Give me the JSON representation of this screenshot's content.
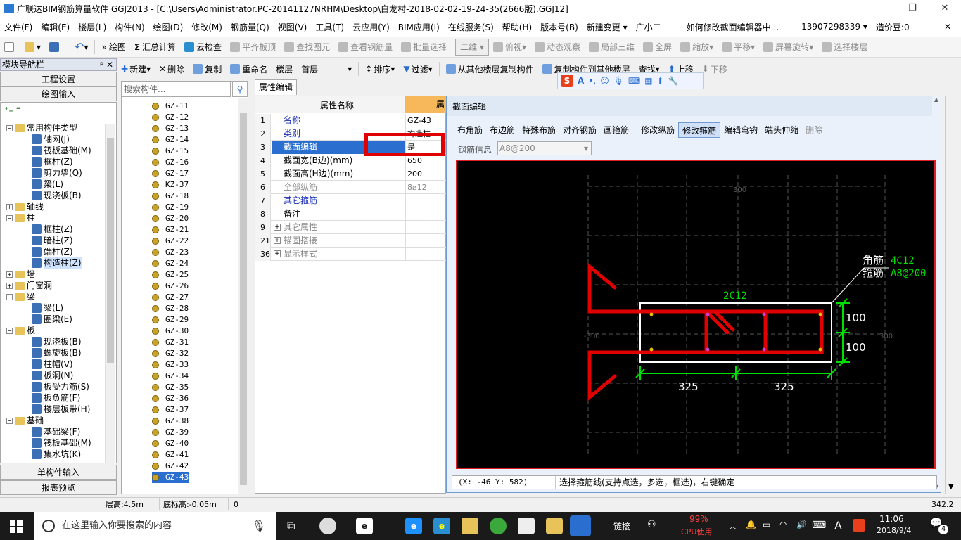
{
  "window": {
    "title": "广联达BIM钢筋算量软件 GGJ2013 - [C:\\Users\\Administrator.PC-20141127NRHM\\Desktop\\白龙村-2018-02-02-19-24-35(2666版).GGJ12]",
    "minimize": "–",
    "restore": "❐",
    "close": "✕"
  },
  "menu": [
    "文件(F)",
    "编辑(E)",
    "楼层(L)",
    "构件(N)",
    "绘图(D)",
    "修改(M)",
    "钢筋量(Q)",
    "视图(V)",
    "工具(T)",
    "云应用(Y)",
    "BIM应用(I)",
    "在线服务(S)",
    "帮助(H)",
    "版本号(B)",
    "新建变更 ▾",
    "广小二",
    "如何修改截面编辑器中...",
    "13907298339 ▾",
    "造价豆:0",
    "✕"
  ],
  "toolbar1": {
    "draw": "绘图",
    "sum": "汇总计算",
    "cloud_check": "云检查",
    "flat_top": "平齐板顶",
    "find_elem": "查找图元",
    "view_rebar": "查看钢筋量",
    "batch_select": "批量选择",
    "view2d": "二维",
    "overlook": "俯视",
    "dyn_observe": "动态观察",
    "local3d": "局部三维",
    "fullscreen": "全屏",
    "zoom": "缩放",
    "pan": "平移",
    "rotate": "屏幕旋转",
    "select_floor": "选择楼层"
  },
  "toolbar2": {
    "new": "新建",
    "delete": "删除",
    "copy": "复制",
    "rename": "重命名",
    "floor_label": "楼层",
    "floor_value": "首层",
    "sort": "排序",
    "filter": "过滤",
    "copy_from": "从其他楼层复制构件",
    "copy_to": "复制构件到其他楼层",
    "find": "查找",
    "up": "上移",
    "down": "下移"
  },
  "nav": {
    "header": "模块导航栏",
    "pin": "ᵖ ✕",
    "project_settings": "工程设置",
    "drawing_input": "绘图输入",
    "single_input": "单构件输入",
    "report_preview": "报表预览",
    "tree": [
      {
        "label": "常用构件类型",
        "type": "folder",
        "level": 0,
        "exp": "−"
      },
      {
        "label": "轴网(J)",
        "type": "comp",
        "level": 1
      },
      {
        "label": "筏板基础(M)",
        "type": "comp",
        "level": 1
      },
      {
        "label": "框柱(Z)",
        "type": "comp",
        "level": 1
      },
      {
        "label": "剪力墙(Q)",
        "type": "comp",
        "level": 1
      },
      {
        "label": "梁(L)",
        "type": "comp",
        "level": 1
      },
      {
        "label": "现浇板(B)",
        "type": "comp",
        "level": 1
      },
      {
        "label": "轴线",
        "type": "folder",
        "level": 0,
        "exp": "+"
      },
      {
        "label": "柱",
        "type": "folder",
        "level": 0,
        "exp": "−"
      },
      {
        "label": "框柱(Z)",
        "type": "comp",
        "level": 1
      },
      {
        "label": "暗柱(Z)",
        "type": "comp",
        "level": 1
      },
      {
        "label": "端柱(Z)",
        "type": "comp",
        "level": 1
      },
      {
        "label": "构造柱(Z)",
        "type": "comp",
        "level": 1,
        "sel": true
      },
      {
        "label": "墙",
        "type": "folder",
        "level": 0,
        "exp": "+"
      },
      {
        "label": "门窗洞",
        "type": "folder",
        "level": 0,
        "exp": "+"
      },
      {
        "label": "梁",
        "type": "folder",
        "level": 0,
        "exp": "−"
      },
      {
        "label": "梁(L)",
        "type": "comp",
        "level": 1
      },
      {
        "label": "圈梁(E)",
        "type": "comp",
        "level": 1
      },
      {
        "label": "板",
        "type": "folder",
        "level": 0,
        "exp": "−"
      },
      {
        "label": "现浇板(B)",
        "type": "comp",
        "level": 1
      },
      {
        "label": "螺旋板(B)",
        "type": "comp",
        "level": 1
      },
      {
        "label": "柱帽(V)",
        "type": "comp",
        "level": 1
      },
      {
        "label": "板洞(N)",
        "type": "comp",
        "level": 1
      },
      {
        "label": "板受力筋(S)",
        "type": "comp",
        "level": 1
      },
      {
        "label": "板负筋(F)",
        "type": "comp",
        "level": 1
      },
      {
        "label": "楼层板带(H)",
        "type": "comp",
        "level": 1
      },
      {
        "label": "基础",
        "type": "folder",
        "level": 0,
        "exp": "−"
      },
      {
        "label": "基础梁(F)",
        "type": "comp",
        "level": 1
      },
      {
        "label": "筏板基础(M)",
        "type": "comp",
        "level": 1
      },
      {
        "label": "集水坑(K)",
        "type": "comp",
        "level": 1
      }
    ]
  },
  "search": {
    "placeholder": "搜索构件...",
    "icon": "⚲"
  },
  "components": [
    "GZ-11",
    "GZ-12",
    "GZ-13",
    "GZ-14",
    "GZ-15",
    "GZ-16",
    "GZ-17",
    "KZ-37",
    "GZ-18",
    "GZ-19",
    "GZ-20",
    "GZ-21",
    "GZ-22",
    "GZ-23",
    "GZ-24",
    "GZ-25",
    "GZ-26",
    "GZ-27",
    "GZ-28",
    "GZ-29",
    "GZ-30",
    "GZ-31",
    "GZ-32",
    "GZ-33",
    "GZ-34",
    "GZ-35",
    "GZ-36",
    "GZ-37",
    "GZ-38",
    "GZ-39",
    "GZ-40",
    "GZ-41",
    "GZ-42",
    "GZ-43"
  ],
  "selected_component": "GZ-43",
  "props": {
    "tab": "属性编辑",
    "col_name": "属性名称",
    "col_value": "属",
    "rows": [
      {
        "num": "1",
        "name": "名称",
        "value": "GZ-43",
        "style": "blue"
      },
      {
        "num": "2",
        "name": "类别",
        "value": "构造柱",
        "style": "blue"
      },
      {
        "num": "3",
        "name": "截面编辑",
        "value": "是",
        "style": "sel"
      },
      {
        "num": "4",
        "name": "截面宽(B边)(mm)",
        "value": "650",
        "style": ""
      },
      {
        "num": "5",
        "name": "截面高(H边)(mm)",
        "value": "200",
        "style": ""
      },
      {
        "num": "6",
        "name": "全部纵筋",
        "value": "8⌀12",
        "style": "gray"
      },
      {
        "num": "7",
        "name": "其它箍筋",
        "value": "",
        "style": "blue"
      },
      {
        "num": "8",
        "name": "备注",
        "value": "",
        "style": ""
      },
      {
        "num": "9",
        "name": "其它属性",
        "value": "",
        "style": "gray",
        "exp": true
      },
      {
        "num": "21",
        "name": "锚固搭接",
        "value": "",
        "style": "gray",
        "exp": true
      },
      {
        "num": "36",
        "name": "显示样式",
        "value": "",
        "style": "gray",
        "exp": true
      }
    ]
  },
  "dialog": {
    "title": "截面编辑",
    "buttons": [
      "布角筋",
      "布边筋",
      "特殊布筋",
      "对齐钢筋",
      "画箍筋",
      "修改纵筋",
      "修改箍筋",
      "编辑弯钩",
      "端头伸缩",
      "删除"
    ],
    "active_button": "修改箍筋",
    "rebar_info_label": "钢筋信息",
    "rebar_info_value": "A8@200",
    "coords": "(X: -46 Y: 582)",
    "hint": "选择箍筋线(支持点选，多选，框选)，右键确定",
    "drawing": {
      "corner_label": "角筋",
      "corner_value": "4C12",
      "stirrup_label": "箍筋",
      "stirrup_value": "A8@200",
      "top_rebar": "2C12",
      "dim_100a": "100",
      "dim_100b": "100",
      "dim_325a": "325",
      "dim_325b": "325",
      "grid_300_top": "300",
      "grid_minus300": "-300",
      "grid_300_right": "300",
      "grid_0": "0"
    }
  },
  "statusbar": {
    "floor_height": "层高:4.5m",
    "bottom_elev": "底标高:-0.05m",
    "zero": "0",
    "fps": "342.2 FPS"
  },
  "sogou": {
    "s": "S",
    "a": "A"
  },
  "taskbar": {
    "search_text": "在这里输入你要搜索的内容",
    "link": "链接",
    "cpu_pct": "99%",
    "cpu_label": "CPU使用",
    "time": "11:06",
    "date": "2018/9/4",
    "notif": "4",
    "lang": "A"
  },
  "colors": {
    "accent": "#2a6fd0",
    "rebar": "#e00000",
    "dim": "#00e000",
    "highlight": "#e00000"
  }
}
